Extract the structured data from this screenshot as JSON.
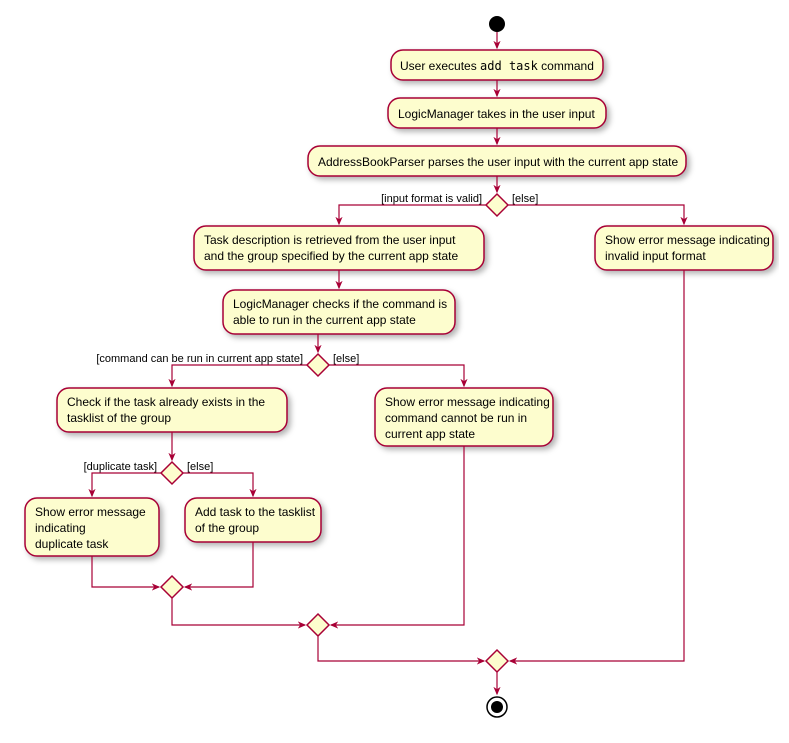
{
  "chart_data": {
    "type": "activity-diagram",
    "title": "",
    "nodes": [
      {
        "id": "start",
        "type": "initial"
      },
      {
        "id": "n1",
        "type": "activity",
        "text_pre": "User executes ",
        "text_mono": "add task",
        "text_post": " command"
      },
      {
        "id": "n2",
        "type": "activity",
        "text": "LogicManager takes in the user input"
      },
      {
        "id": "n3",
        "type": "activity",
        "text": "AddressBookParser parses the user input with the current app state"
      },
      {
        "id": "d1",
        "type": "decision",
        "left_guard": "[input format is valid]",
        "right_guard": "[else]"
      },
      {
        "id": "n4",
        "type": "activity",
        "lines": [
          "Task description is retrieved from the user input",
          "and the group specified by the current app state"
        ]
      },
      {
        "id": "n5",
        "type": "activity",
        "lines": [
          "Show error message indicating",
          "invalid input format"
        ]
      },
      {
        "id": "n6",
        "type": "activity",
        "lines": [
          "LogicManager checks if the command is",
          "able to run in the current app state"
        ]
      },
      {
        "id": "d2",
        "type": "decision",
        "left_guard": "[command can be run in current app state]",
        "right_guard": "[else]"
      },
      {
        "id": "n7",
        "type": "activity",
        "lines": [
          "Check if the task already exists in the",
          "tasklist of the group"
        ]
      },
      {
        "id": "n8",
        "type": "activity",
        "lines": [
          "Show error message indicating",
          " command cannot be run in",
          "current app state"
        ]
      },
      {
        "id": "d3",
        "type": "decision",
        "left_guard": "[duplicate task]",
        "right_guard": "[else]"
      },
      {
        "id": "n9",
        "type": "activity",
        "lines": [
          "Show error message",
          "indicating",
          "duplicate task"
        ]
      },
      {
        "id": "n10",
        "type": "activity",
        "lines": [
          "Add task to the tasklist",
          "of the group"
        ]
      },
      {
        "id": "m3",
        "type": "merge"
      },
      {
        "id": "m2",
        "type": "merge"
      },
      {
        "id": "m1",
        "type": "merge"
      },
      {
        "id": "end",
        "type": "final"
      }
    ],
    "edges": [
      {
        "from": "start",
        "to": "n1"
      },
      {
        "from": "n1",
        "to": "n2"
      },
      {
        "from": "n2",
        "to": "n3"
      },
      {
        "from": "n3",
        "to": "d1"
      },
      {
        "from": "d1",
        "to": "n4",
        "guard": "[input format is valid]"
      },
      {
        "from": "d1",
        "to": "n5",
        "guard": "[else]"
      },
      {
        "from": "n4",
        "to": "n6"
      },
      {
        "from": "n6",
        "to": "d2"
      },
      {
        "from": "d2",
        "to": "n7",
        "guard": "[command can be run in current app state]"
      },
      {
        "from": "d2",
        "to": "n8",
        "guard": "[else]"
      },
      {
        "from": "n7",
        "to": "d3"
      },
      {
        "from": "d3",
        "to": "n9",
        "guard": "[duplicate task]"
      },
      {
        "from": "d3",
        "to": "n10",
        "guard": "[else]"
      },
      {
        "from": "n9",
        "to": "m3"
      },
      {
        "from": "n10",
        "to": "m3"
      },
      {
        "from": "m3",
        "to": "m2"
      },
      {
        "from": "n8",
        "to": "m2"
      },
      {
        "from": "m2",
        "to": "m1"
      },
      {
        "from": "n5",
        "to": "m1"
      },
      {
        "from": "m1",
        "to": "end"
      }
    ]
  }
}
